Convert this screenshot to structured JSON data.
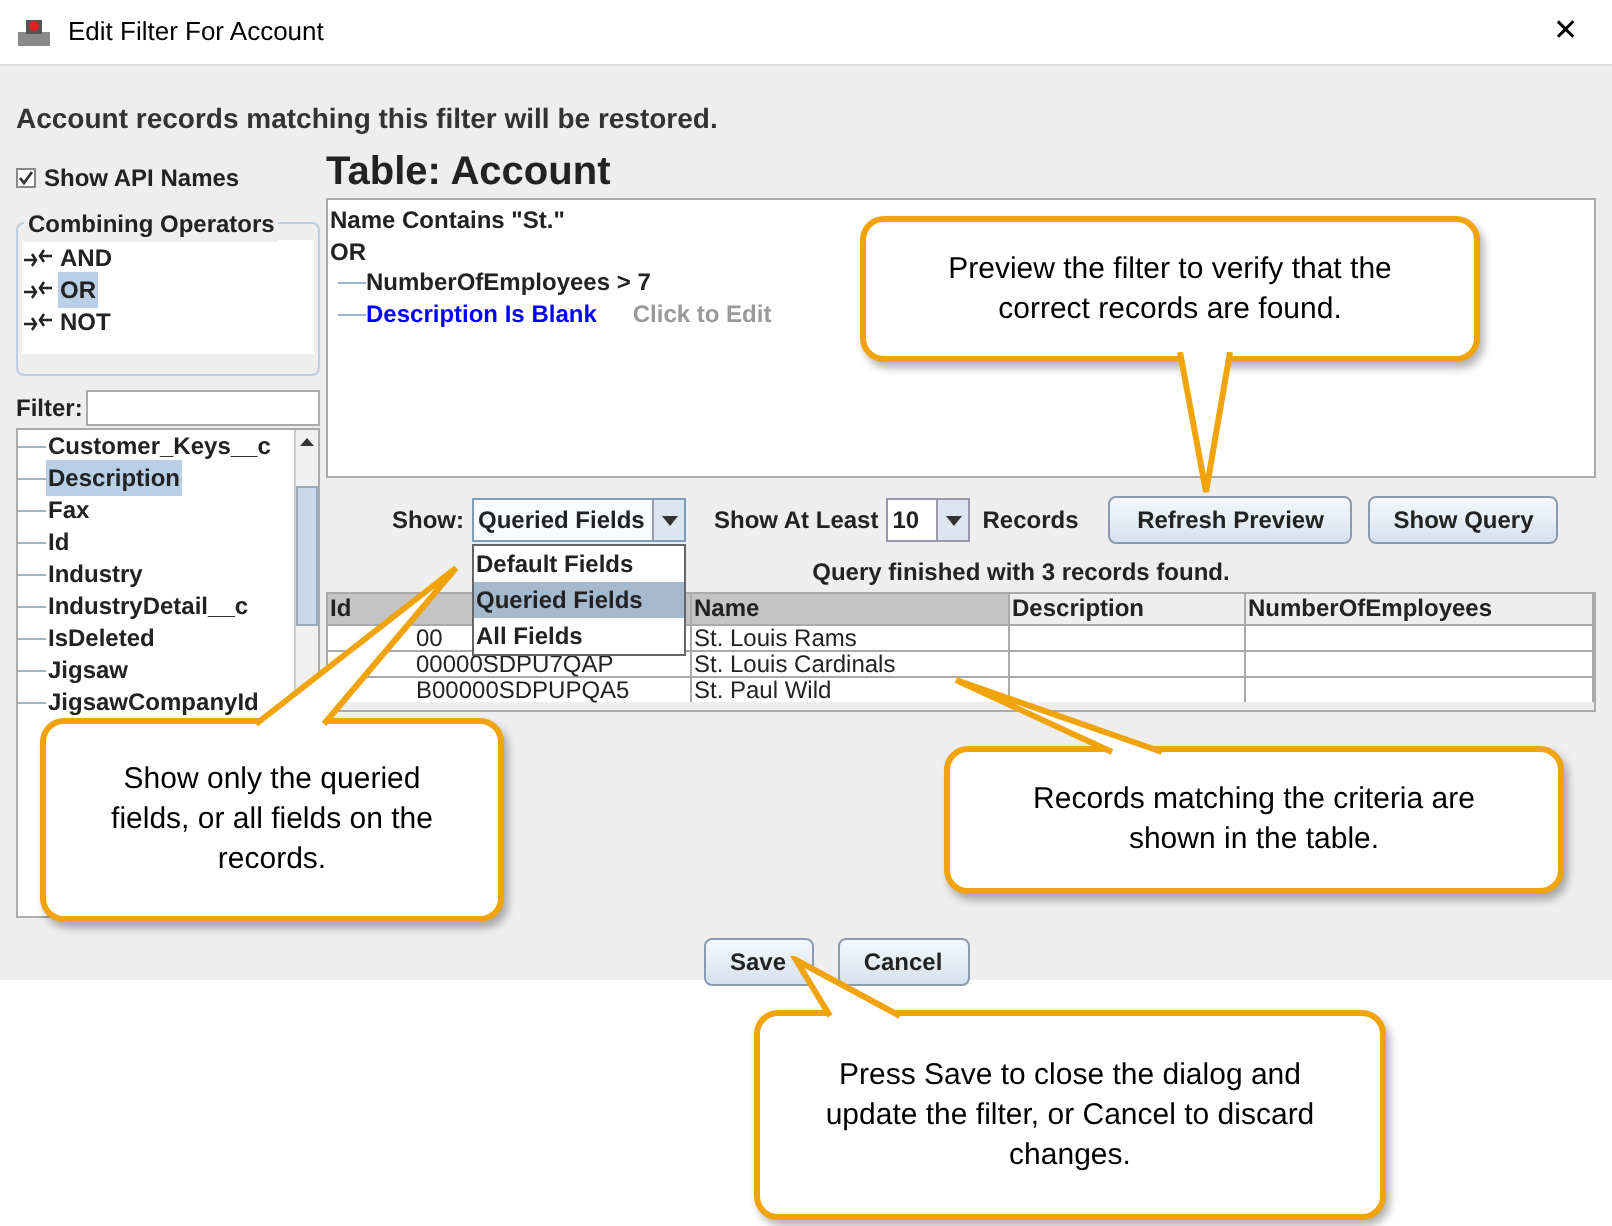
{
  "window": {
    "title": "Edit Filter For Account",
    "close": "✕"
  },
  "heading": "Account records matching this filter will be restored.",
  "show_api_names": {
    "label": "Show API Names",
    "checked": true
  },
  "operators": {
    "title": "Combining Operators",
    "items": [
      {
        "label": "AND",
        "selected": false
      },
      {
        "label": "OR",
        "selected": true
      },
      {
        "label": "NOT",
        "selected": false
      }
    ]
  },
  "filter": {
    "label": "Filter:"
  },
  "fields": [
    {
      "label": "Customer_Keys__c",
      "selected": false
    },
    {
      "label": "Description",
      "selected": true
    },
    {
      "label": "Fax",
      "selected": false
    },
    {
      "label": "Id",
      "selected": false
    },
    {
      "label": "Industry",
      "selected": false
    },
    {
      "label": "IndustryDetail__c",
      "selected": false
    },
    {
      "label": "IsDeleted",
      "selected": false
    },
    {
      "label": "Jigsaw",
      "selected": false
    },
    {
      "label": "JigsawCompanyId",
      "selected": false
    }
  ],
  "table_title": "Table: Account",
  "filter_tree": {
    "first": "Name Contains \"St.\"",
    "operator": "OR",
    "children": [
      {
        "text": "NumberOfEmployees > 7",
        "selected": false
      },
      {
        "text": "Description Is Blank",
        "selected": true,
        "hint": "Click to Edit"
      }
    ]
  },
  "controls": {
    "show_label": "Show:",
    "show_value": "Queried Fields",
    "expanded": true,
    "show_options": [
      {
        "label": "Default Fields",
        "selected": false
      },
      {
        "label": "Queried Fields",
        "selected": true
      },
      {
        "label": "All Fields",
        "selected": false
      }
    ],
    "atleast_label": "Show At Least",
    "atleast_value": "10",
    "records_label": "Records",
    "buttons": [
      "Refresh Preview",
      "Show Query"
    ]
  },
  "status": "Query finished with 3 records found.",
  "table": {
    "columns": [
      "Id",
      "Name",
      "Description",
      "NumberOfEmployees"
    ],
    "rows": [
      [
        "00",
        "St. Louis Rams",
        "",
        ""
      ],
      [
        "00000SDPU7QAP",
        "St. Louis Cardinals",
        "",
        ""
      ],
      [
        "B00000SDPUPQA5",
        "St. Paul Wild",
        "",
        ""
      ]
    ]
  },
  "buttons": [
    "Save",
    "Cancel"
  ],
  "callouts": [
    {
      "text": "Preview the filter to verify that the correct records are found."
    },
    {
      "text": "Show only the queried fields, or all fields on the records."
    },
    {
      "text": "Records matching the criteria are shown in the table."
    },
    {
      "text": "Press Save to close the dialog and update the filter, or Cancel to discard changes."
    }
  ]
}
